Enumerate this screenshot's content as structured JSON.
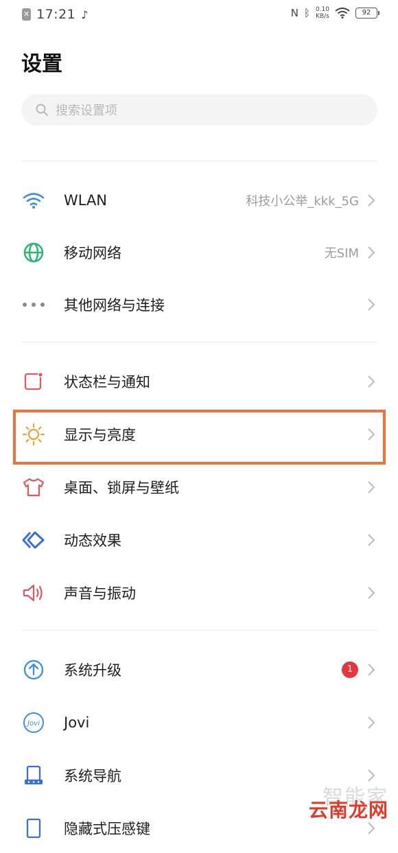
{
  "status_bar": {
    "time": "17:21",
    "net_speed_value": "0.10",
    "net_speed_unit": "KB/s",
    "battery": "92"
  },
  "page": {
    "title": "设置"
  },
  "search": {
    "placeholder": "搜索设置项"
  },
  "groups": {
    "network": [
      {
        "label": "WLAN",
        "value": "科技小公举_kkk_5G",
        "icon": "wifi-icon"
      },
      {
        "label": "移动网络",
        "value": "无SIM",
        "icon": "globe-icon"
      },
      {
        "label": "其他网络与连接",
        "value": "",
        "icon": "more-dots-icon"
      }
    ],
    "display": [
      {
        "label": "状态栏与通知",
        "icon": "notification-icon"
      },
      {
        "label": "显示与亮度",
        "icon": "brightness-icon"
      },
      {
        "label": "桌面、锁屏与壁纸",
        "icon": "shirt-icon"
      },
      {
        "label": "动态效果",
        "icon": "motion-icon"
      },
      {
        "label": "声音与振动",
        "icon": "speaker-icon"
      }
    ],
    "system": [
      {
        "label": "系统升级",
        "badge": "1",
        "icon": "upgrade-arrow-icon"
      },
      {
        "label": "Jovi",
        "icon": "jovi-icon"
      },
      {
        "label": "系统导航",
        "icon": "navigation-icon"
      },
      {
        "label": "隐藏式压感键",
        "icon": "pressure-key-icon"
      }
    ]
  },
  "watermark": {
    "top": "智能家",
    "bottom": "云南龙网"
  },
  "colors": {
    "highlight": "#ef7337",
    "badge": "#e8343d",
    "wifi": "#3a8ee6",
    "globe": "#2bb673"
  }
}
